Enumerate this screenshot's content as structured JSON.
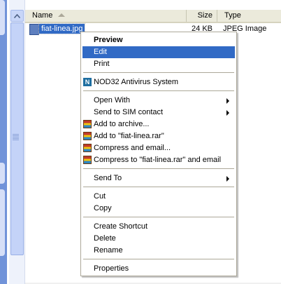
{
  "columns": {
    "name": "Name",
    "size": "Size",
    "type": "Type"
  },
  "file": {
    "name": "fiat-linea.jpg",
    "size": "24 KB",
    "type": "JPEG Image"
  },
  "icons": {
    "file": "jpeg-file-icon",
    "archive": "winrar-icon",
    "antivirus": "nod32-icon",
    "submenu": "submenu-arrow-icon",
    "sort": "sort-ascending-icon"
  },
  "menu": {
    "preview": "Preview",
    "edit": "Edit",
    "print": "Print",
    "nod32": "NOD32 Antivirus System",
    "open_with": "Open With",
    "send_to_sim": "Send to SIM contact",
    "add_archive": "Add to archive...",
    "add_rar": "Add to \"fiat-linea.rar\"",
    "compress_email": "Compress and email...",
    "compress_rar_email": "Compress to \"fiat-linea.rar\" and email",
    "send_to": "Send To",
    "cut": "Cut",
    "copy": "Copy",
    "create_shortcut": "Create Shortcut",
    "delete": "Delete",
    "rename": "Rename",
    "properties": "Properties"
  },
  "nod_glyph": "N",
  "colors": {
    "selection": "#316ac5",
    "header": "#ebeadb",
    "pane": "#7193d9"
  }
}
